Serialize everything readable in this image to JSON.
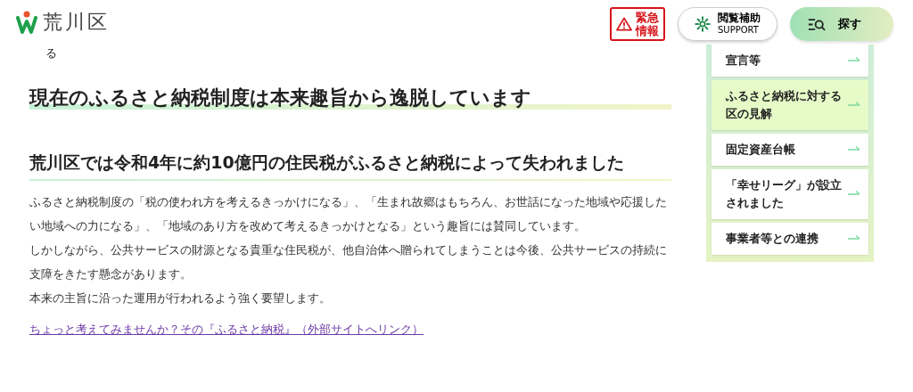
{
  "header": {
    "logo_text": "荒川区",
    "emergency": {
      "label_line1": "緊急",
      "label_line2": "情報"
    },
    "support": {
      "label": "閲覧補助",
      "sublabel": "SUPPORT"
    },
    "search": {
      "label": "探す"
    }
  },
  "cut_text": "る",
  "main": {
    "title": "現在のふるさと納税制度は本来趣旨から逸脱しています",
    "subtitle": "荒川区では令和4年に約10億円の住民税がふるさと納税によって失われました",
    "paragraphs": [
      "ふるさと納税制度の「税の使われ方を考えるきっかけになる」、「生まれ故郷はもちろん、お世話になった地域や応援したい地域への力になる」、「地域のあり方を改めて考えるきっかけとなる」という趣旨には賛同しています。",
      "しかしながら、公共サービスの財源となる貴重な住民税が、他自治体へ贈られてしまうことは今後、公共サービスの持続に支障をきたす懸念があります。",
      "本来の主旨に沿った運用が行われるよう強く要望します。"
    ],
    "link": "ちょっと考えてみませんか？その『ふるさと納税』（外部サイトへリンク）"
  },
  "sidebar": {
    "items": [
      {
        "label": "宣言等",
        "selected": false
      },
      {
        "label": "ふるさと納税に対する区の見解",
        "selected": true
      },
      {
        "label": "固定資産台帳",
        "selected": false
      },
      {
        "label": "「幸せリーグ」が設立されました",
        "selected": false
      },
      {
        "label": "事業者等との連携",
        "selected": false
      }
    ]
  }
}
